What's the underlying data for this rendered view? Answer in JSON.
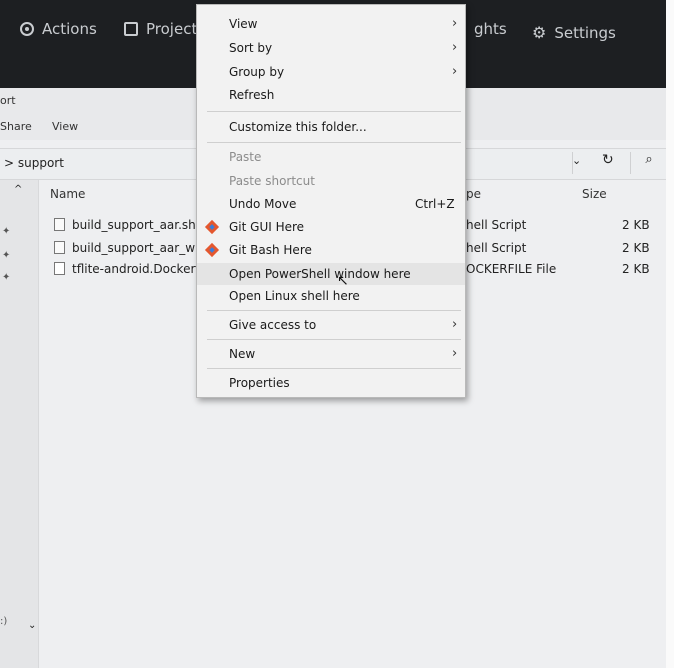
{
  "header": {
    "actions_label": "Actions",
    "projects_label": "Project",
    "insights_label": "ghts",
    "settings_label": "Settings"
  },
  "ribbon": {
    "title_fragment": "ort",
    "share_label": "Share",
    "view_label": "View"
  },
  "address": {
    "crumb": "> support",
    "chevron": "⌄",
    "refresh": "↻",
    "search": "⌕"
  },
  "columns": {
    "name": "Name",
    "type": "pe",
    "size": "Size"
  },
  "files": [
    {
      "name": "build_support_aar.sh",
      "type": "hell Script",
      "size": "2 KB"
    },
    {
      "name": "build_support_aar_with",
      "type": "hell Script",
      "size": "2 KB"
    },
    {
      "name": "tflite-android.Dockerfil",
      "type": "OCKERFILE File",
      "size": "2 KB"
    }
  ],
  "context_menu": {
    "view": "View",
    "sort_by": "Sort by",
    "group_by": "Group by",
    "refresh": "Refresh",
    "customize": "Customize this folder...",
    "paste": "Paste",
    "paste_shortcut": "Paste shortcut",
    "undo_move": "Undo Move",
    "undo_shortcut": "Ctrl+Z",
    "git_gui": "Git GUI Here",
    "git_bash": "Git Bash Here",
    "powershell": "Open PowerShell window here",
    "linux_shell": "Open Linux shell here",
    "give_access": "Give access to",
    "new": "New",
    "properties": "Properties"
  },
  "nav": {
    "up": "^",
    "down": "⌄",
    "pin": "✦",
    "paren": ":)"
  },
  "colors": {
    "header_bg": "#1d1f22",
    "menu_bg": "#f2f2f2",
    "hover_bg": "#e4e4e4"
  }
}
